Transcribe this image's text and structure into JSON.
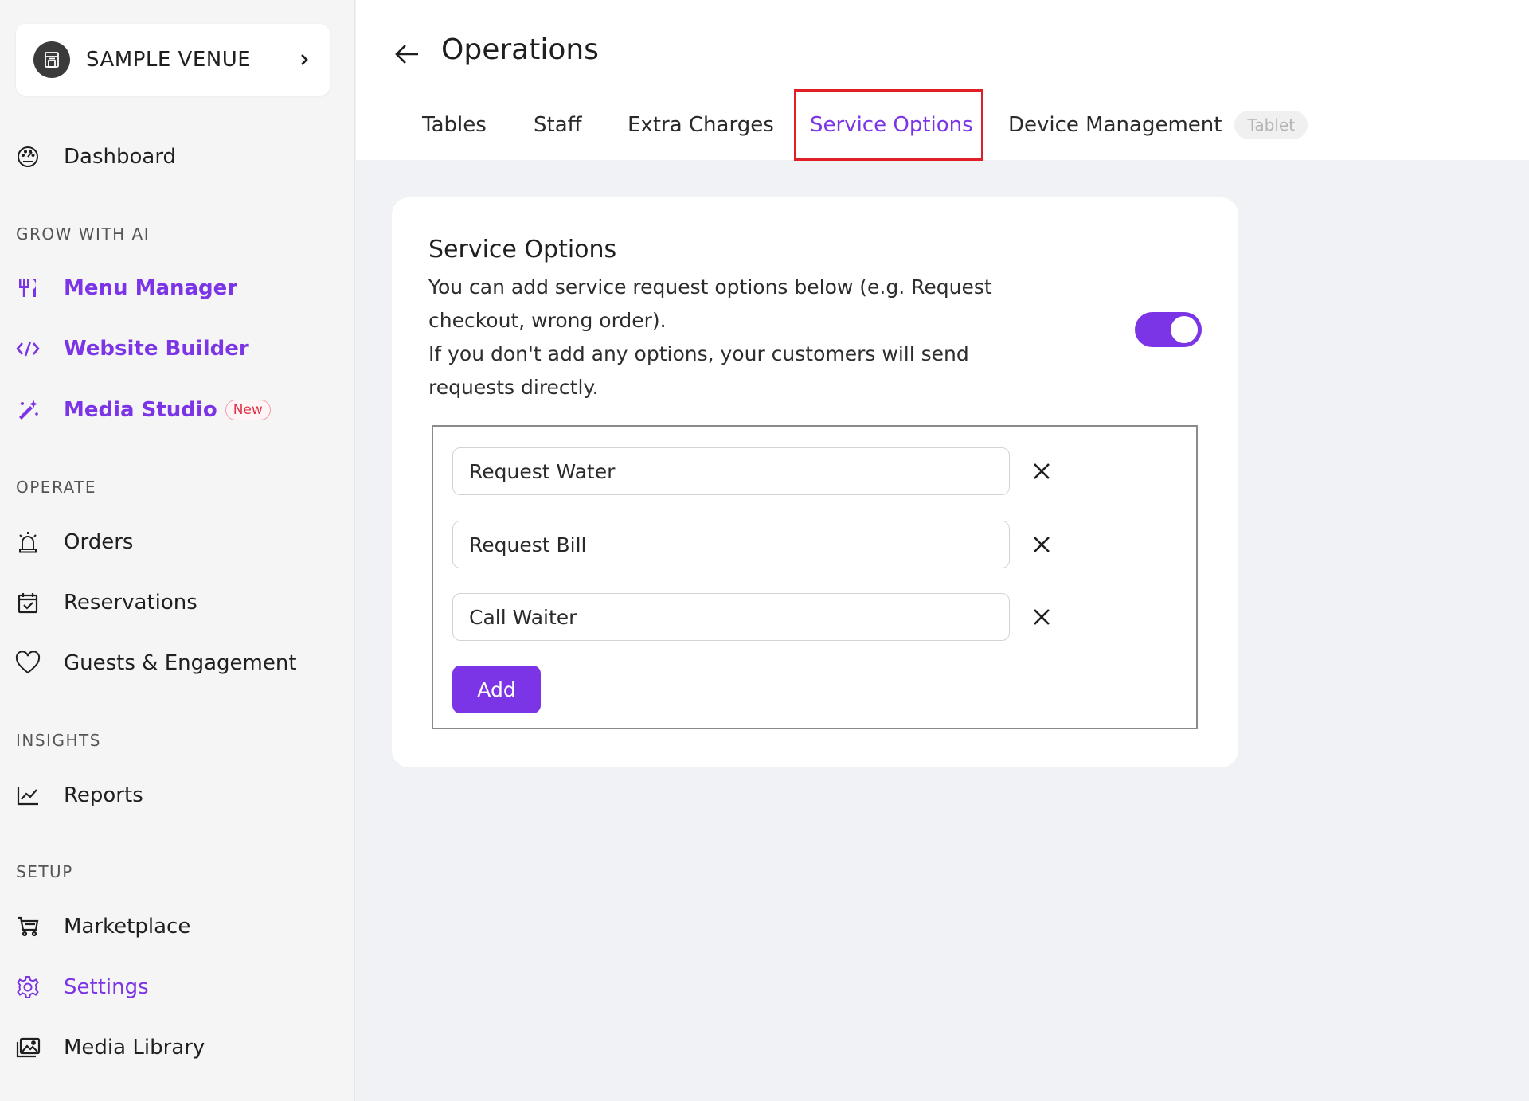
{
  "venue": {
    "name": "SAMPLE VENUE"
  },
  "sidebar": {
    "dashboard": "Dashboard",
    "sections": {
      "grow": "GROW WITH AI",
      "operate": "OPERATE",
      "insights": "INSIGHTS",
      "setup": "SETUP"
    },
    "grow_items": [
      {
        "label": "Menu Manager",
        "icon": "fork-knife-icon"
      },
      {
        "label": "Website Builder",
        "icon": "code-icon"
      },
      {
        "label": "Media Studio",
        "icon": "magic-wand-icon",
        "badge": "New"
      }
    ],
    "operate_items": [
      {
        "label": "Orders",
        "icon": "alarm-bell-icon"
      },
      {
        "label": "Reservations",
        "icon": "calendar-check-icon"
      },
      {
        "label": "Guests & Engagement",
        "icon": "heart-icon"
      }
    ],
    "insights_items": [
      {
        "label": "Reports",
        "icon": "line-chart-icon"
      }
    ],
    "setup_items": [
      {
        "label": "Marketplace",
        "icon": "cart-icon"
      },
      {
        "label": "Settings",
        "icon": "gear-icon",
        "active": true
      },
      {
        "label": "Media Library",
        "icon": "images-icon"
      }
    ]
  },
  "header": {
    "title": "Operations",
    "tabs": [
      {
        "label": "Tables"
      },
      {
        "label": "Staff"
      },
      {
        "label": "Extra Charges"
      },
      {
        "label": "Service Options",
        "active": true
      },
      {
        "label": "Device Management",
        "badge": "Tablet"
      }
    ]
  },
  "service_options": {
    "title": "Service Options",
    "desc_line1": "You can add service request options below (e.g. Request",
    "desc_line2": "checkout, wrong order).",
    "desc_line3": "If you don't add any options, your customers will send",
    "desc_line4": "requests directly.",
    "enabled": true,
    "options": [
      "Request Water",
      "Request Bill",
      "Call Waiter"
    ],
    "add_label": "Add"
  },
  "colors": {
    "accent": "#7c35e6",
    "highlight": "#e01e26",
    "new_badge": "#e0334b"
  }
}
